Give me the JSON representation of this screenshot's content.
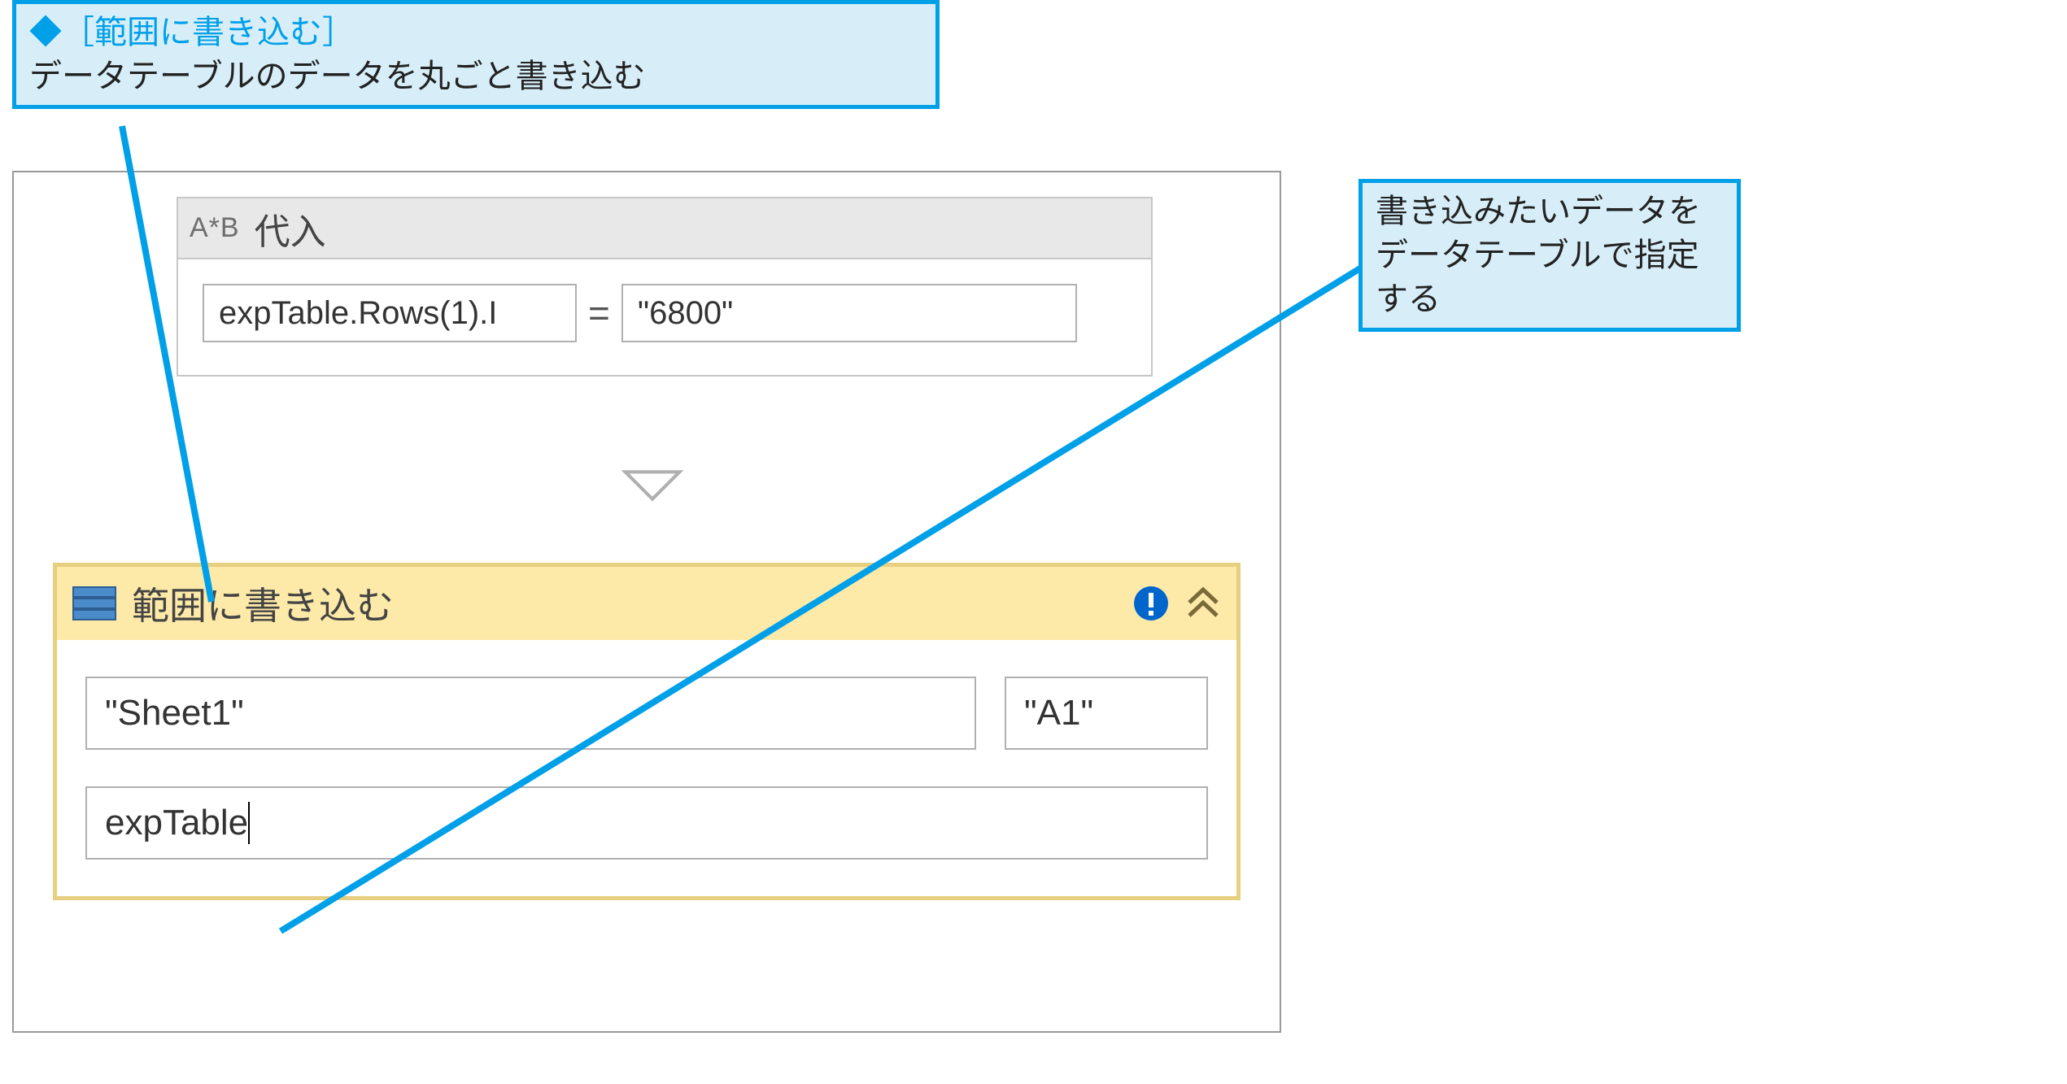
{
  "callouts": {
    "top": {
      "title": "◆［範囲に書き込む］",
      "body": "データテーブルのデータを丸ごと書き込む"
    },
    "right": {
      "body": "書き込みたいデータをデータテーブルで指定する"
    }
  },
  "assign": {
    "glyph": "A*B",
    "title": "代入",
    "lhs": "expTable.Rows(1).I",
    "eq": "=",
    "rhs": "\"6800\""
  },
  "write_range": {
    "title": "範囲に書き込む",
    "sheet": "\"Sheet1\"",
    "cell": "\"A1\"",
    "data": "expTable"
  }
}
